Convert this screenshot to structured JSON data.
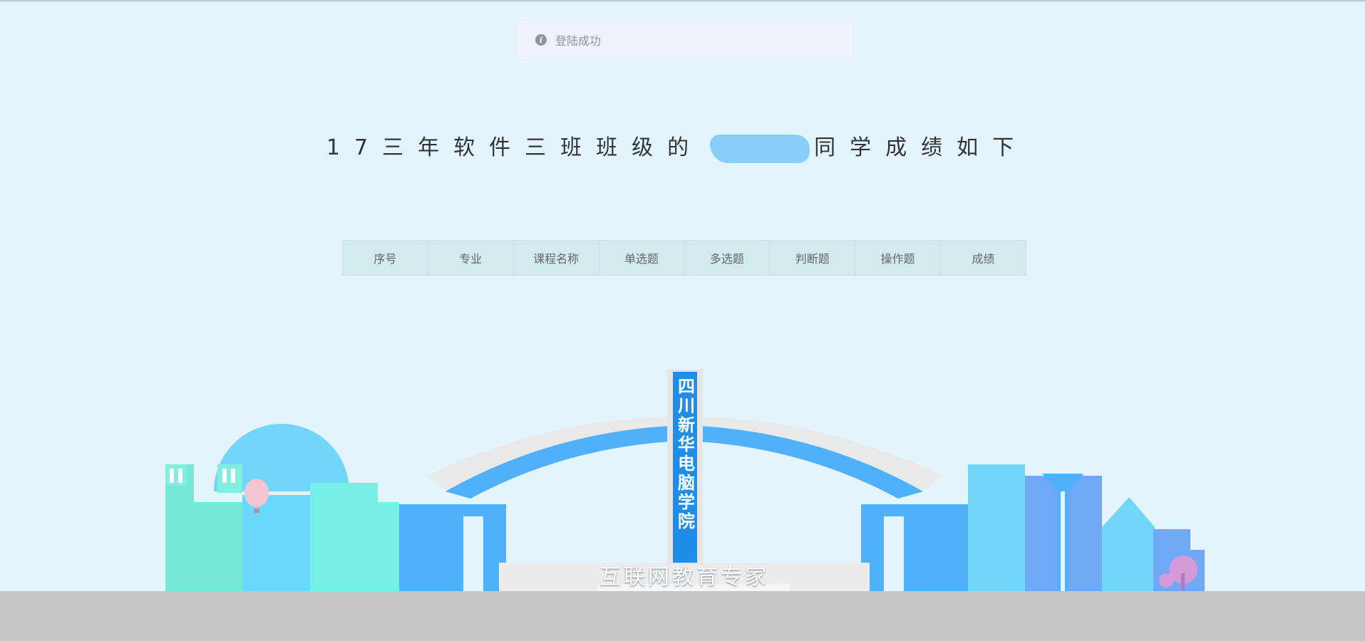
{
  "toast": {
    "icon": "info-icon",
    "message": "登陆成功"
  },
  "title": {
    "prefix": "17三年软件三班班级的",
    "suffix": "同学成绩如下"
  },
  "table": {
    "headers": [
      "序号",
      "专业",
      "课程名称",
      "单选题",
      "多选题",
      "判断题",
      "操作题",
      "成绩"
    ]
  },
  "illustration": {
    "gate_sign": "四川新华电脑学院",
    "slogan": "互联网教育专家"
  },
  "colors": {
    "background": "#e3f4fd",
    "table_header": "#d2ebef",
    "gate_blue": "#4fb1fa",
    "ground": "#c6c6c6"
  }
}
